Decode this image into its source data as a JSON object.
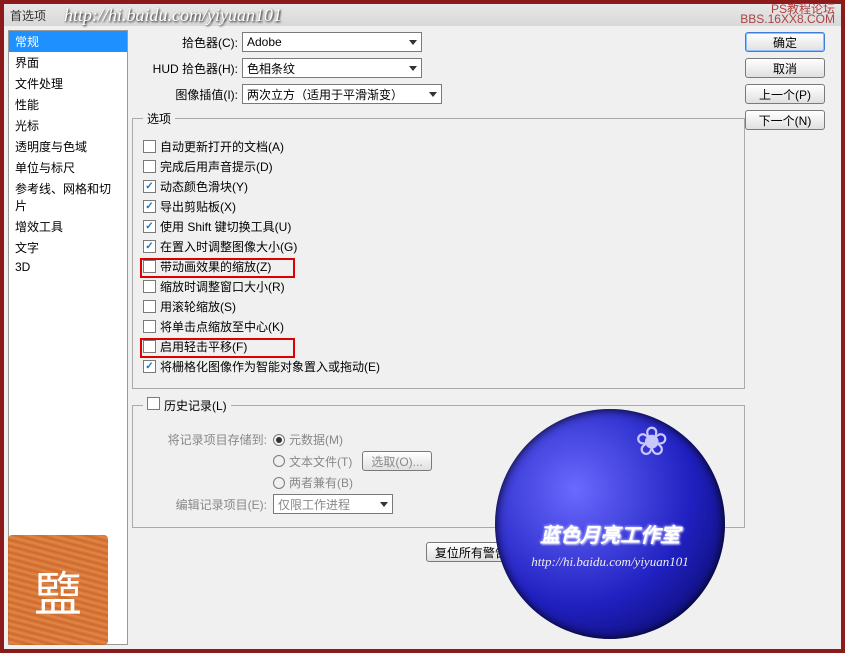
{
  "titlebar": {
    "title": "首选项",
    "url": "http://hi.baidu.com/yiyuan101",
    "forum_line1": "PS教程论坛",
    "forum_line2": "BBS.16XX8.COM"
  },
  "sidebar": {
    "items": [
      {
        "label": "常规",
        "selected": true
      },
      {
        "label": "界面"
      },
      {
        "label": "文件处理"
      },
      {
        "label": "性能"
      },
      {
        "label": "光标"
      },
      {
        "label": "透明度与色域"
      },
      {
        "label": "单位与标尺"
      },
      {
        "label": "参考线、网格和切片"
      },
      {
        "label": "增效工具"
      },
      {
        "label": "文字"
      },
      {
        "label": "3D"
      }
    ]
  },
  "top": {
    "picker_label": "拾色器(C):",
    "picker_value": "Adobe",
    "hud_label": "HUD 拾色器(H):",
    "hud_value": "色相条纹",
    "interp_label": "图像插值(I):",
    "interp_value": "两次立方（适用于平滑渐变）"
  },
  "options_legend": "选项",
  "opts": {
    "o0": {
      "checked": false,
      "label": "自动更新打开的文档(A)"
    },
    "o1": {
      "checked": false,
      "label": "完成后用声音提示(D)"
    },
    "o2": {
      "checked": true,
      "label": "动态颜色滑块(Y)"
    },
    "o3": {
      "checked": true,
      "label": "导出剪贴板(X)"
    },
    "o4": {
      "checked": true,
      "label": "使用 Shift 键切换工具(U)"
    },
    "o5": {
      "checked": true,
      "label": "在置入时调整图像大小(G)"
    },
    "o6": {
      "checked": false,
      "label": "带动画效果的缩放(Z)"
    },
    "o7": {
      "checked": false,
      "label": "缩放时调整窗口大小(R)"
    },
    "o8": {
      "checked": false,
      "label": "用滚轮缩放(S)"
    },
    "o9": {
      "checked": false,
      "label": "将单击点缩放至中心(K)"
    },
    "o10": {
      "checked": false,
      "label": "启用轻击平移(F)"
    },
    "o11": {
      "checked": true,
      "label": "将栅格化图像作为智能对象置入或拖动(E)"
    }
  },
  "history": {
    "legend_checked": false,
    "legend_label": "历史记录(L)",
    "save_to_label": "将记录项目存储到:",
    "r_meta": "元数据(M)",
    "r_text": "文本文件(T)",
    "r_both": "两者兼有(B)",
    "choose_btn": "选取(O)...",
    "edit_label": "编辑记录项目(E):",
    "edit_value": "仅限工作进程"
  },
  "reset_btn": "复位所有警告对话框(W)",
  "buttons": {
    "ok": "确定",
    "cancel": "取消",
    "prev": "上一个(P)",
    "next": "下一个(N)"
  },
  "watermark": {
    "title": "蓝色月亮工作室",
    "url": "http://hi.baidu.com/yiyuan101"
  },
  "seal_char": "盬"
}
